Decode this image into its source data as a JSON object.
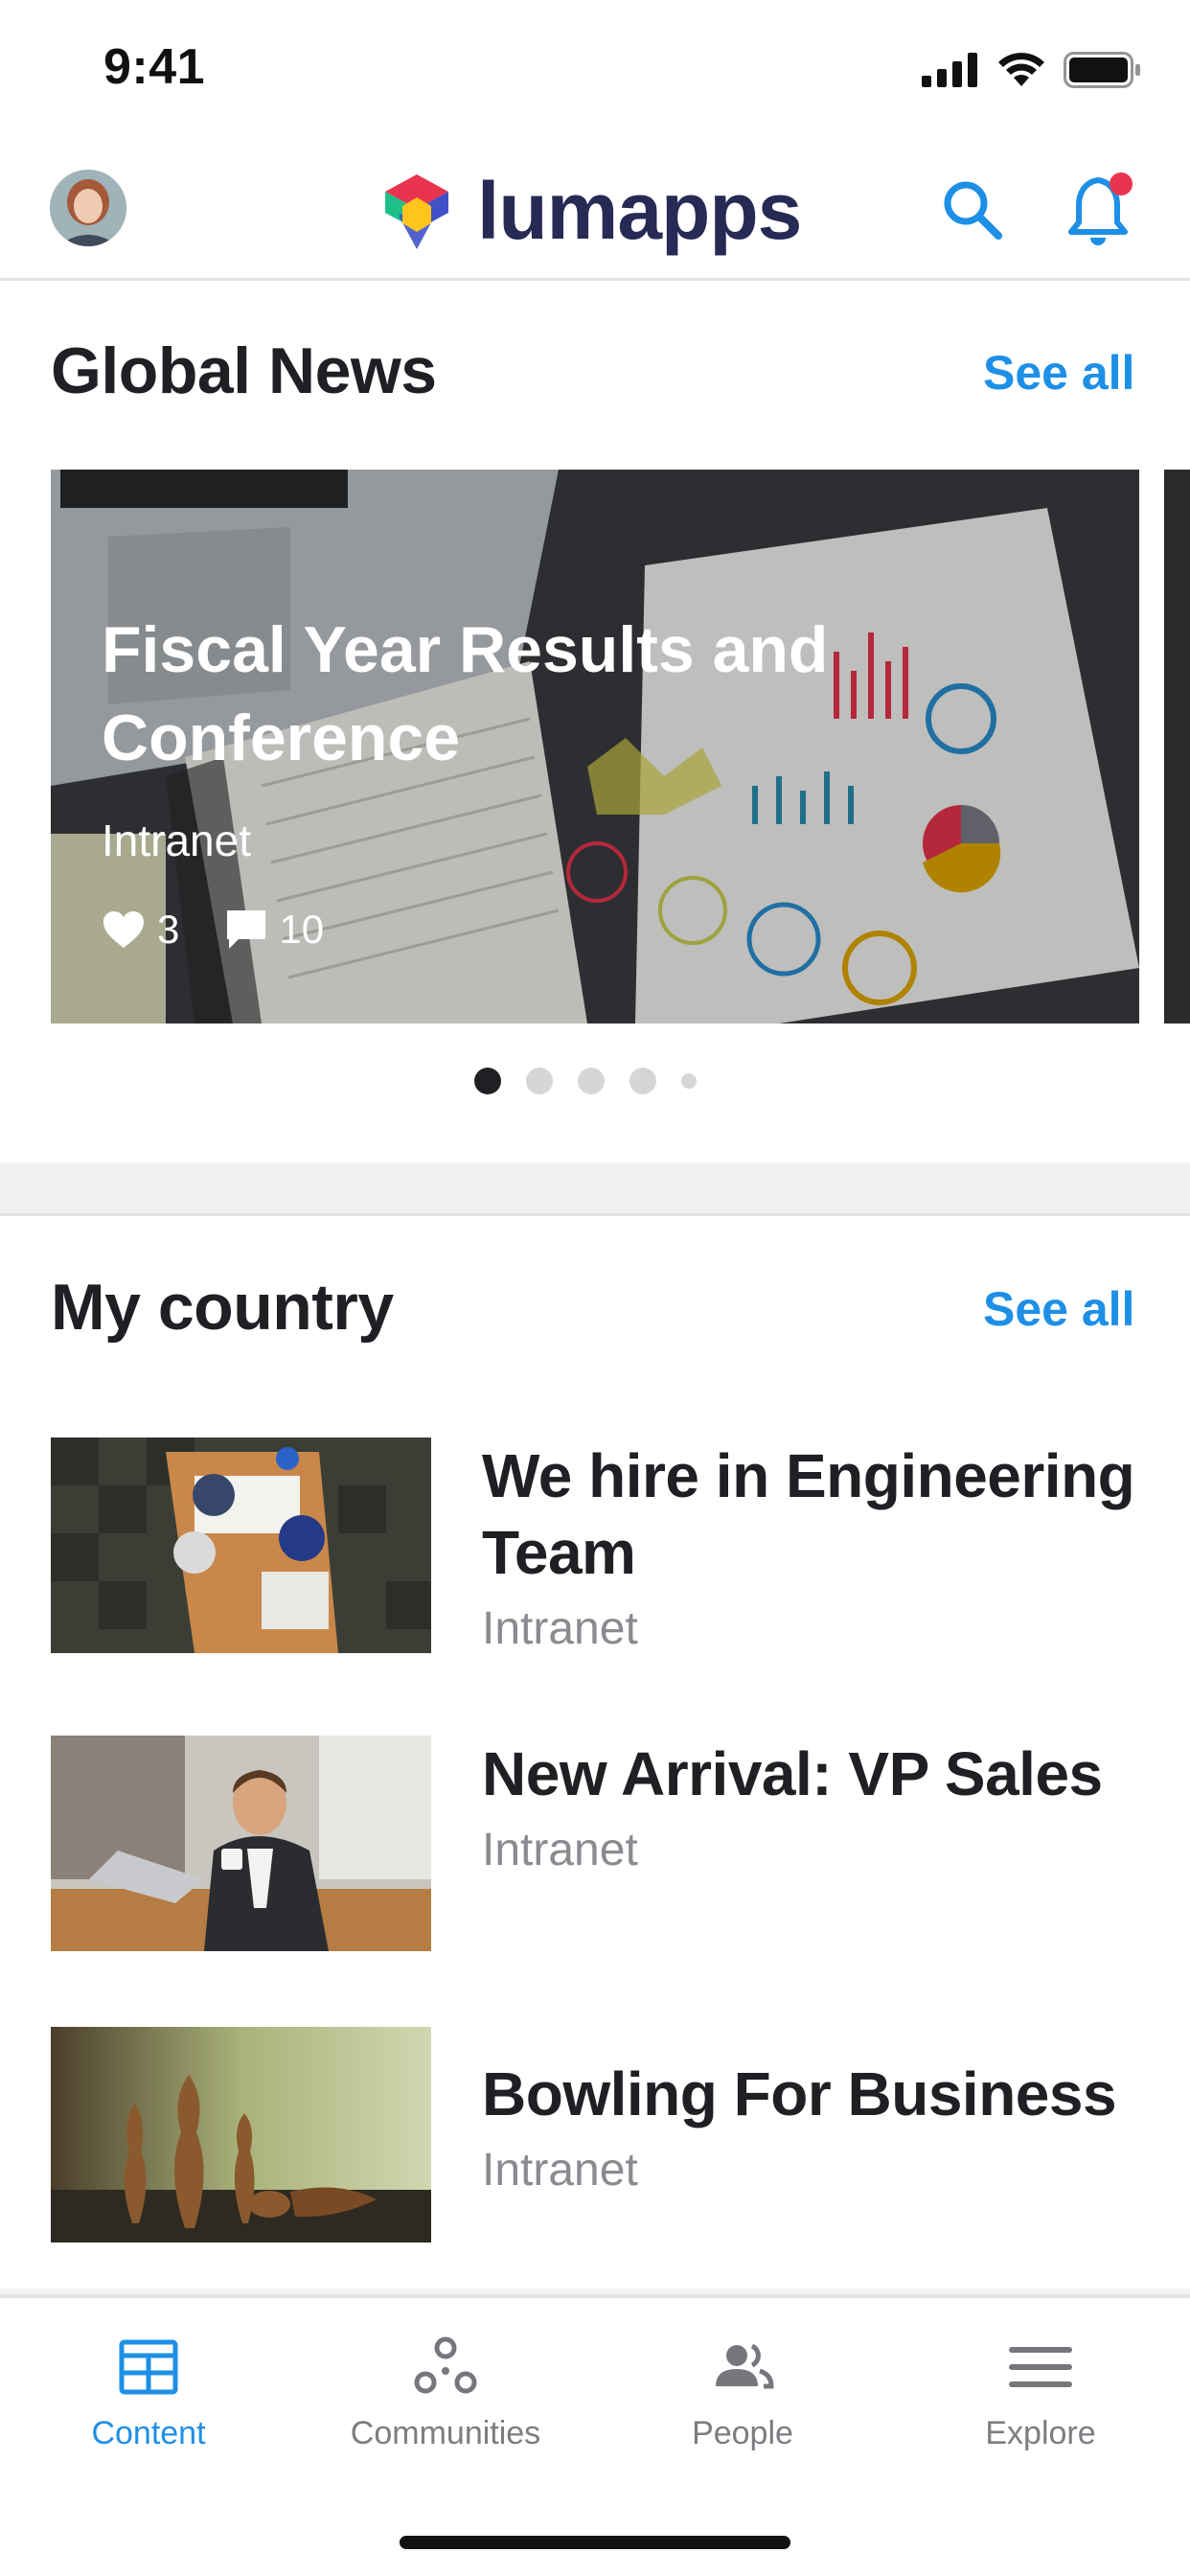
{
  "status_bar": {
    "time": "9:41"
  },
  "header": {
    "brand": "lumapps",
    "accent_color": "#1e8fe6",
    "notification_dot_color": "#e8344e"
  },
  "global_news": {
    "title": "Global News",
    "see_all": "See all",
    "featured": {
      "title": "Fiscal Year Results and Conference",
      "source": "Intranet",
      "likes": "3",
      "comments": "10"
    },
    "carousel_pages": 5,
    "carousel_active_index": 0
  },
  "my_country": {
    "title": "My country",
    "see_all": "See all",
    "items": [
      {
        "title": "We hire in Engineering Team",
        "source": "Intranet"
      },
      {
        "title": "New Arrival: VP Sales",
        "source": "Intranet"
      },
      {
        "title": "Bowling For Business",
        "source": "Intranet"
      }
    ]
  },
  "tab_bar": {
    "tabs": [
      {
        "label": "Content",
        "icon": "content-icon",
        "active": true
      },
      {
        "label": "Communities",
        "icon": "communities-icon",
        "active": false
      },
      {
        "label": "People",
        "icon": "people-icon",
        "active": false
      },
      {
        "label": "Explore",
        "icon": "menu-icon",
        "active": false
      }
    ]
  }
}
